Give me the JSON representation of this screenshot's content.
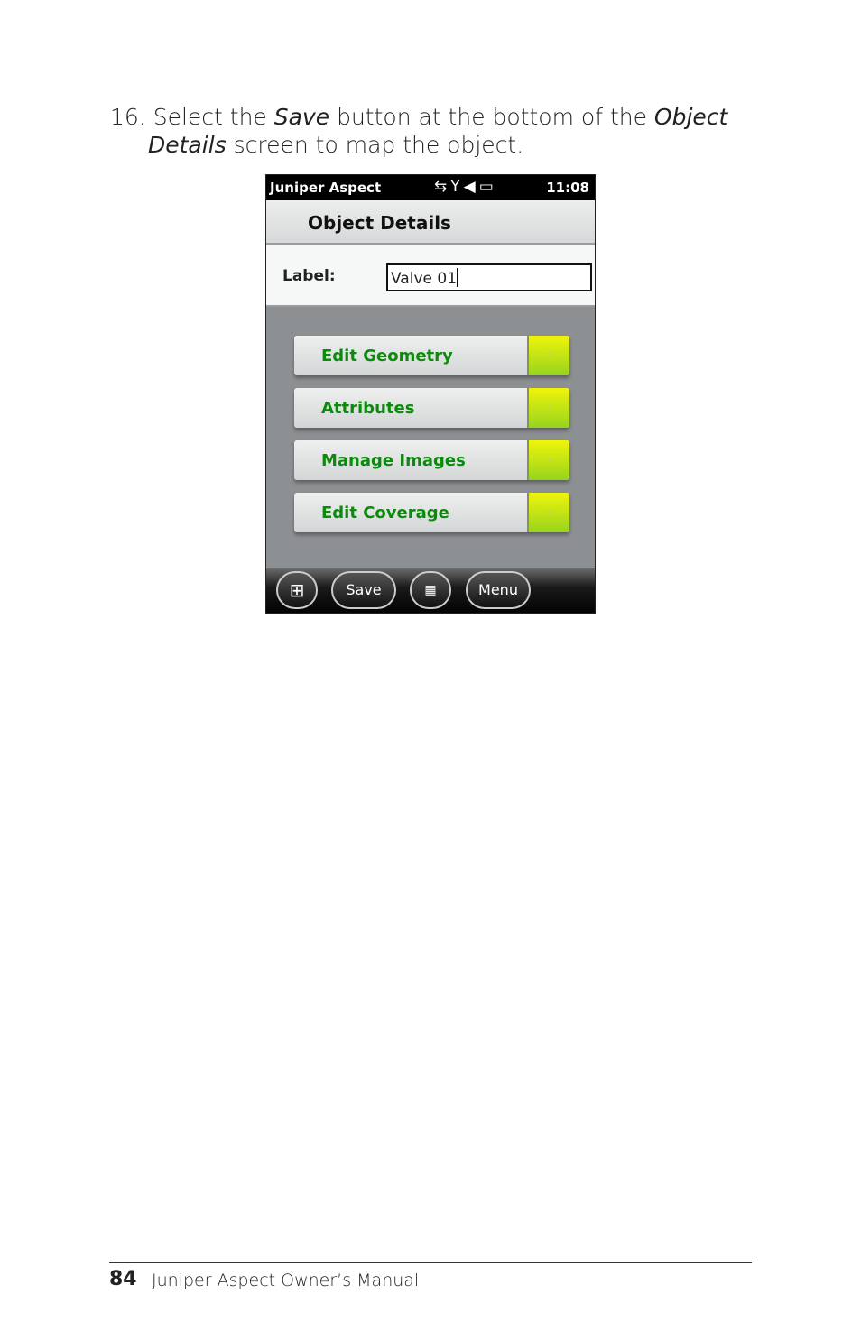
{
  "instruction": {
    "number": "16.",
    "parts": [
      "Select the ",
      "Save",
      " button at the bottom of the ",
      "Object"
    ],
    "line2_parts": [
      "Details",
      " screen to map the object."
    ]
  },
  "device": {
    "status_bar": {
      "app_name": "Juniper Aspect",
      "time": "11:08",
      "icons": [
        "sync-disconnected-icon",
        "no-signal-icon",
        "volume-muted-icon",
        "battery-icon"
      ]
    },
    "title": "Object Details",
    "label_field": {
      "label": "Label:",
      "value": "Valve 01"
    },
    "buttons": [
      {
        "label": "Edit Geometry"
      },
      {
        "label": "Attributes"
      },
      {
        "label": "Manage Images"
      },
      {
        "label": "Edit Coverage"
      }
    ],
    "softkeys": {
      "save": "Save",
      "menu": "Menu"
    },
    "colors": {
      "button_text": "#0c8a0c",
      "button_accent": "#c8ec14"
    }
  },
  "footer": {
    "page_number": "84",
    "title": "Juniper Aspect Owner’s Manual"
  }
}
